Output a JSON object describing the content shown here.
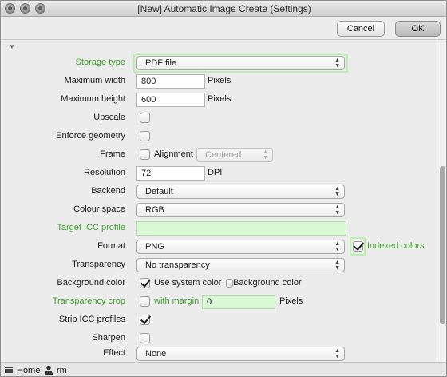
{
  "window": {
    "title": "[New] Automatic Image Create (Settings)"
  },
  "toolbar": {
    "cancel_label": "Cancel",
    "ok_label": "OK"
  },
  "form": {
    "storage_type": {
      "label": "Storage type",
      "value": "PDF file"
    },
    "max_width": {
      "label": "Maximum width",
      "value": "800",
      "unit": "Pixels"
    },
    "max_height": {
      "label": "Maximum height",
      "value": "600",
      "unit": "Pixels"
    },
    "upscale": {
      "label": "Upscale",
      "checked": false
    },
    "enforce_geometry": {
      "label": "Enforce geometry",
      "checked": false
    },
    "frame": {
      "label": "Frame",
      "checked": false,
      "alignment_label": "Alignment",
      "alignment_value": "Centered"
    },
    "resolution": {
      "label": "Resolution",
      "value": "72",
      "unit": "DPI"
    },
    "backend": {
      "label": "Backend",
      "value": "Default"
    },
    "colour_space": {
      "label": "Colour space",
      "value": "RGB"
    },
    "target_icc": {
      "label": "Target ICC profile",
      "value": ""
    },
    "format": {
      "label": "Format",
      "value": "PNG",
      "indexed_label": "Indexed colors",
      "indexed_checked": true
    },
    "transparency": {
      "label": "Transparency",
      "value": "No transparency"
    },
    "background_color": {
      "label": "Background color",
      "use_system_label": "Use system color",
      "use_system_checked": true,
      "bg_label": "Background color",
      "bg_checked": false
    },
    "transparency_crop": {
      "label": "Transparency crop",
      "checked": false,
      "margin_label": "with margin",
      "margin_value": "0",
      "unit": "Pixels"
    },
    "strip_icc": {
      "label": "Strip ICC profiles",
      "checked": true
    },
    "sharpen": {
      "label": "Sharpen",
      "checked": false
    },
    "effect": {
      "label": "Effect",
      "value": "None"
    }
  },
  "statusbar": {
    "home_label": "Home",
    "user_label": "rm"
  },
  "colors": {
    "accent_green": "#3f9f2c",
    "field_green": "#d9f9d5"
  }
}
